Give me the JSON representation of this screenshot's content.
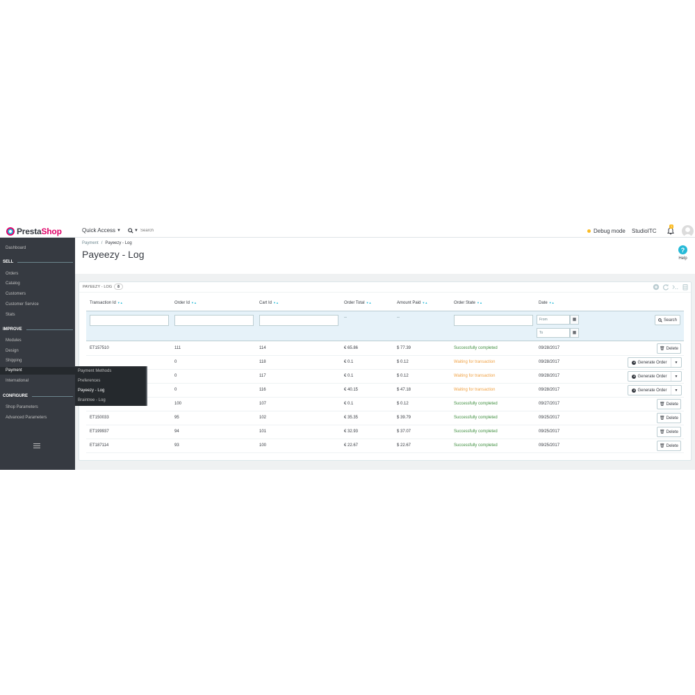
{
  "header": {
    "logo_text_a": "Presta",
    "logo_text_b": "Shop",
    "quick_access": "Quick Access",
    "search_placeholder": "Search",
    "debug_mode": "Debug mode",
    "shop_name": "StudioITC",
    "notification_count": "1"
  },
  "sidebar": {
    "dashboard": "Dashboard",
    "section_sell": "SELL",
    "orders": "Orders",
    "catalog": "Catalog",
    "customers": "Customers",
    "customer_service": "Customer Service",
    "stats": "Stats",
    "section_improve": "IMPROVE",
    "modules": "Modules",
    "design": "Design",
    "shipping": "Shipping",
    "payment": "Payment",
    "international": "International",
    "section_configure": "CONFIGURE",
    "shop_parameters": "Shop Parameters",
    "advanced_parameters": "Advanced Parameters"
  },
  "submenu": {
    "payment_methods": "Payment Methods",
    "preferences": "Preferences",
    "payeezy_log": "Payeezy - Log",
    "braintree_log": "Braintree - Log"
  },
  "page": {
    "breadcrumb_parent": "Payment",
    "breadcrumb_sep": "/",
    "breadcrumb_current": "Payeezy - Log",
    "title": "Payeezy - Log",
    "help": "Help"
  },
  "panel": {
    "title": "PAYEEZY - LOG",
    "count": "8"
  },
  "table": {
    "columns": {
      "transaction_id": "Transaction Id",
      "order_id": "Order Id",
      "cart_id": "Cart Id",
      "order_total": "Order Total",
      "amount_paid": "Amount Paid",
      "order_state": "Order State",
      "date": "Date"
    },
    "filter": {
      "dash_total": "--",
      "dash_paid": "--",
      "from_placeholder": "From",
      "to_placeholder": "To",
      "search_label": "Search"
    },
    "delete_label": "Delete",
    "generate_label": "Generate Order",
    "rows": [
      {
        "tid": "ET157510",
        "order": "111",
        "cart": "114",
        "total": "€ 65.86",
        "paid": "$ 77.39",
        "state": "Successfully completed",
        "date": "09/28/2017",
        "ok": true
      },
      {
        "tid": "",
        "order": "0",
        "cart": "118",
        "total": "€ 0.1",
        "paid": "$ 0.12",
        "state": "Waiting for transaction",
        "date": "09/28/2017",
        "ok": false
      },
      {
        "tid": "",
        "order": "0",
        "cart": "117",
        "total": "€ 0.1",
        "paid": "$ 0.12",
        "state": "Waiting for transaction",
        "date": "09/28/2017",
        "ok": false
      },
      {
        "tid": "",
        "order": "0",
        "cart": "116",
        "total": "€ 40.15",
        "paid": "$ 47.18",
        "state": "Waiting for transaction",
        "date": "09/28/2017",
        "ok": false
      },
      {
        "tid": "",
        "order": "100",
        "cart": "107",
        "total": "€ 0.1",
        "paid": "$ 0.12",
        "state": "Successfully completed",
        "date": "09/27/2017",
        "ok": true
      },
      {
        "tid": "ET150033",
        "order": "95",
        "cart": "102",
        "total": "€ 35.35",
        "paid": "$ 39.79",
        "state": "Successfully completed",
        "date": "09/25/2017",
        "ok": true
      },
      {
        "tid": "ET199937",
        "order": "94",
        "cart": "101",
        "total": "€ 32.93",
        "paid": "$ 37.07",
        "state": "Successfully completed",
        "date": "09/25/2017",
        "ok": true
      },
      {
        "tid": "ET187114",
        "order": "93",
        "cart": "100",
        "total": "€ 22.67",
        "paid": "$ 22.67",
        "state": "Successfully completed",
        "date": "09/25/2017",
        "ok": true
      }
    ]
  },
  "colors": {
    "sidebar_bg": "#363a41",
    "accent": "#25b9d7",
    "success": "#3e8e3e",
    "warning": "#f0a143",
    "brand_pink": "#df0067"
  }
}
